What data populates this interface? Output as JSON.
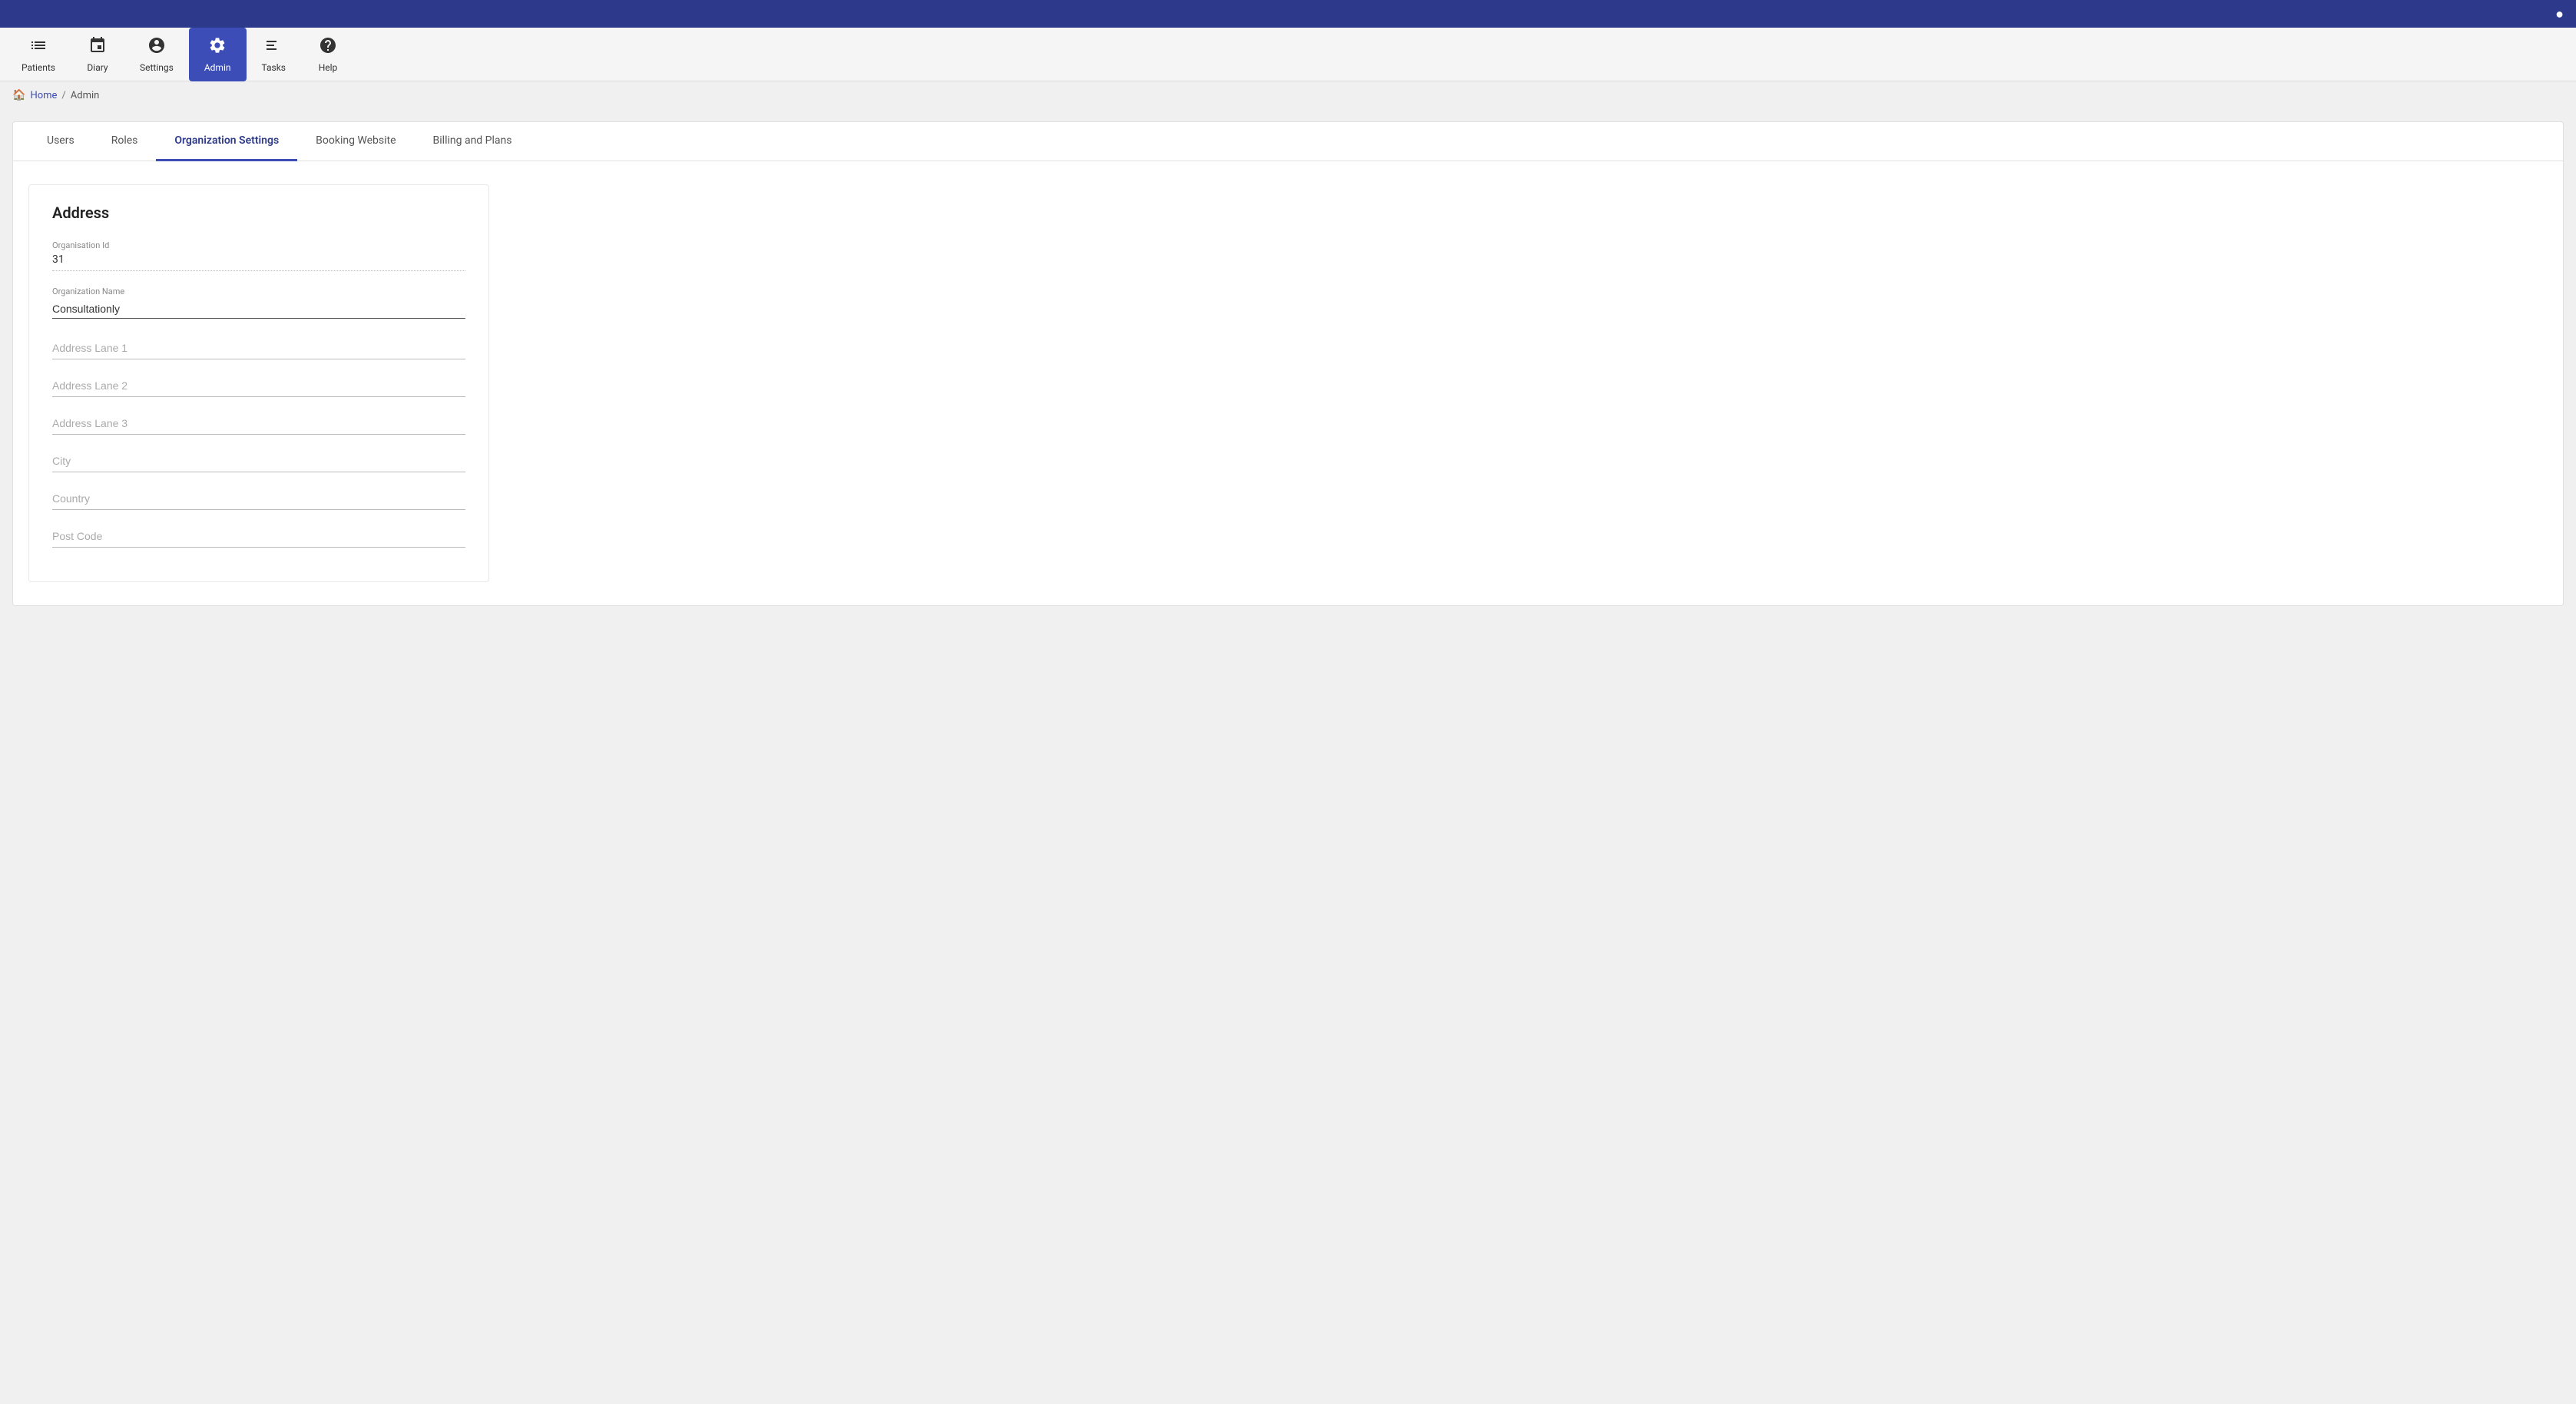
{
  "topBar": {
    "userIconLabel": "user"
  },
  "nav": {
    "items": [
      {
        "id": "patients",
        "label": "Patients",
        "icon": "patients",
        "active": false
      },
      {
        "id": "diary",
        "label": "Diary",
        "icon": "diary",
        "active": false
      },
      {
        "id": "settings",
        "label": "Settings",
        "icon": "settings",
        "active": false
      },
      {
        "id": "admin",
        "label": "Admin",
        "icon": "admin",
        "active": true
      },
      {
        "id": "tasks",
        "label": "Tasks",
        "icon": "tasks",
        "active": false
      },
      {
        "id": "help",
        "label": "Help",
        "icon": "help",
        "active": false
      }
    ]
  },
  "breadcrumb": {
    "home": "Home",
    "separator": "/",
    "current": "Admin"
  },
  "tabs": {
    "items": [
      {
        "id": "users",
        "label": "Users",
        "active": false
      },
      {
        "id": "roles",
        "label": "Roles",
        "active": false
      },
      {
        "id": "organization-settings",
        "label": "Organization Settings",
        "active": true
      },
      {
        "id": "booking-website",
        "label": "Booking Website",
        "active": false
      },
      {
        "id": "billing-and-plans",
        "label": "Billing and Plans",
        "active": false
      }
    ]
  },
  "addressForm": {
    "title": "Address",
    "orgIdLabel": "Organisation Id",
    "orgIdValue": "31",
    "orgNameLabel": "Organization Name",
    "orgNameValue": "Consultationly",
    "addressLane1Label": "Address Lane 1",
    "addressLane1Value": "",
    "addressLane2Label": "Address Lane 2",
    "addressLane2Value": "",
    "addressLane3Label": "Address Lane 3",
    "addressLane3Value": "",
    "cityLabel": "City",
    "cityValue": "",
    "countryLabel": "Country",
    "countryValue": "",
    "postCodeLabel": "Post Code",
    "postCodeValue": ""
  }
}
